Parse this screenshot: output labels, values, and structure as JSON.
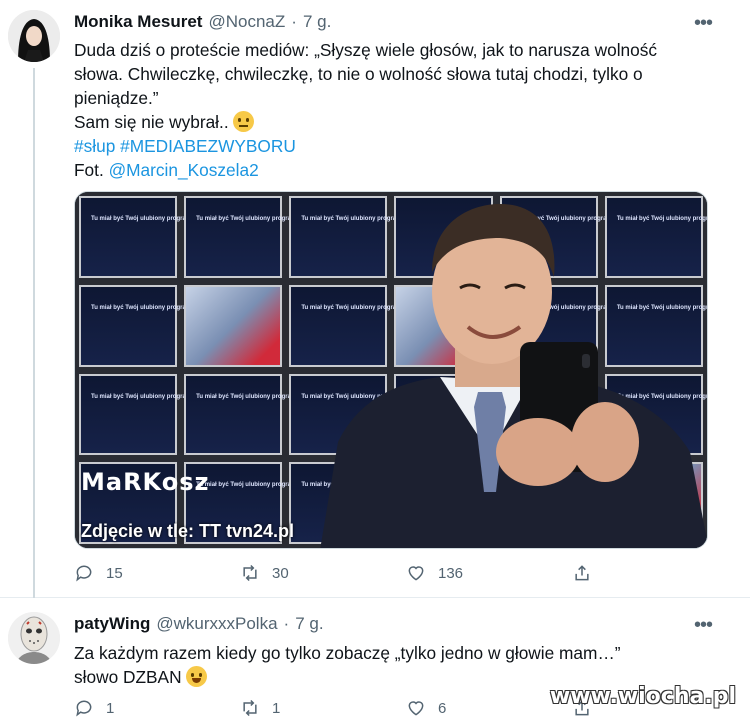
{
  "tweets": [
    {
      "name": "Monika Mesuret",
      "handle": "@NocnaZ",
      "separator": "·",
      "time": "7 g.",
      "lines": [
        "Duda dziś o proteście mediów: „Słyszę wiele głosów, jak to narusza wolność",
        "słowa. Chwileczkę, chwileczkę, to nie o wolność słowa tutaj chodzi, tylko o",
        "pieniądze.”"
      ],
      "line4": "Sam się nie wybrał..",
      "hashtags": "#słup #MEDIABEZWYBORU",
      "photo_prefix": "Fot. ",
      "photo_mention": "@Marcin_Koszela2",
      "media": {
        "screen_text": "Tu miał być Twój ulubiony program",
        "watermark": "MaRKosz",
        "caption": "Zdjęcie w tle: TT tvn24.pl"
      },
      "stats": {
        "replies": "15",
        "retweets": "30",
        "likes": "136"
      }
    },
    {
      "name": "patyWing",
      "handle": "@wkurxxxPolka",
      "separator": "·",
      "time": "7 g.",
      "line1": "Za każdym razem kiedy go tylko zobaczę „tylko jedno w głowie mam…”",
      "line2": "słowo DZBAN",
      "stats": {
        "replies": "1",
        "retweets": "1",
        "likes": "6"
      }
    }
  ],
  "site_watermark": "www.wiocha.pl",
  "colors": {
    "link": "#1b95e0",
    "muted": "#536471",
    "text": "#0f1419"
  },
  "icons": [
    "more-icon",
    "reply-icon",
    "retweet-icon",
    "like-icon",
    "share-icon"
  ]
}
